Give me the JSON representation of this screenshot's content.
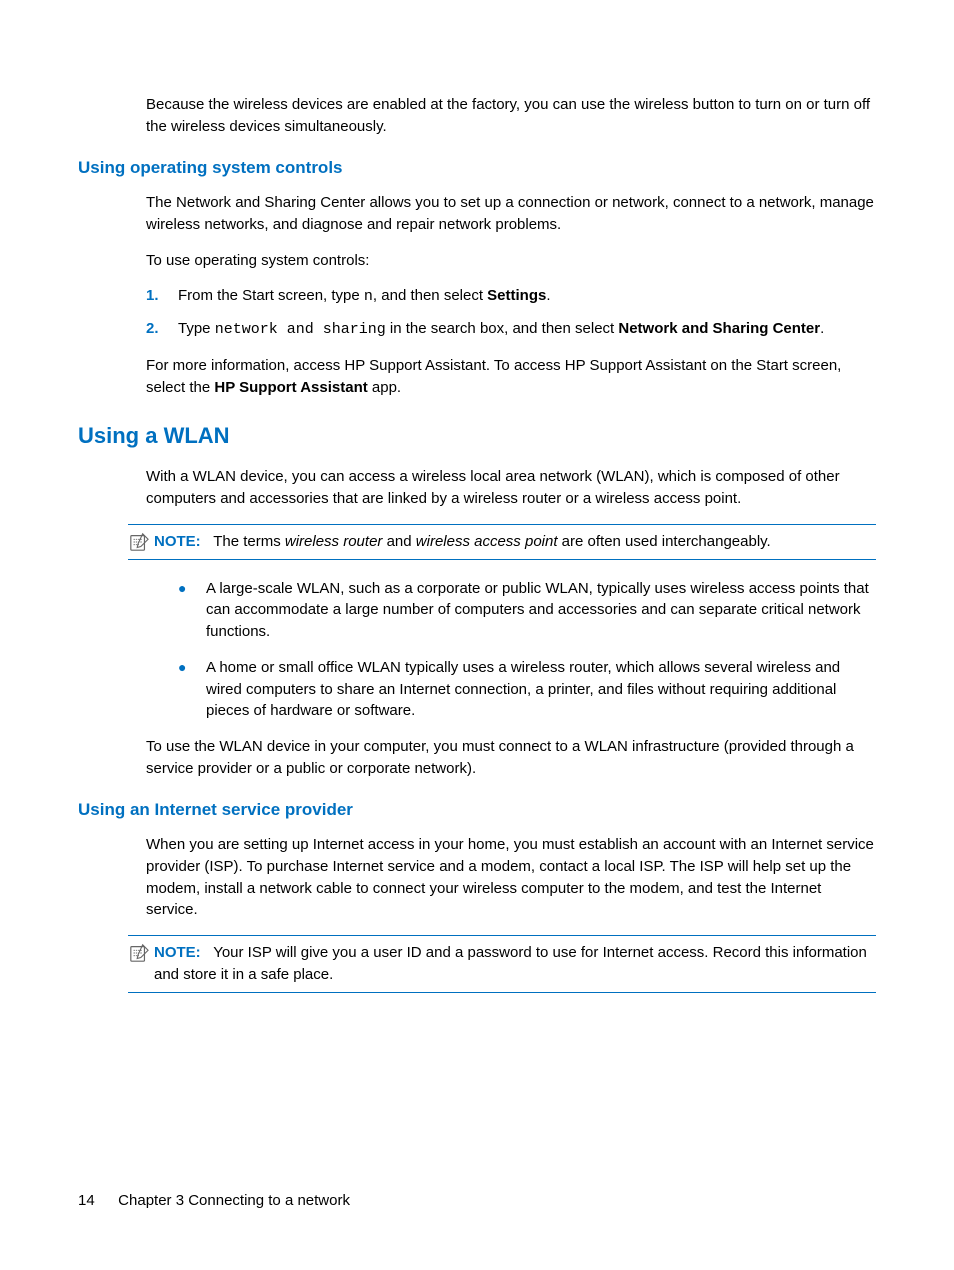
{
  "intro": "Because the wireless devices are enabled at the factory, you can use the wireless button to turn on or turn off the wireless devices simultaneously.",
  "s1": {
    "heading": "Using operating system controls",
    "p1": "The Network and Sharing Center allows you to set up a connection or network, connect to a network, manage wireless networks, and diagnose and repair network problems.",
    "p2": "To use operating system controls:",
    "li1_num": "1.",
    "li1_a": "From the Start screen, type ",
    "li1_mono": "n",
    "li1_b": ", and then select ",
    "li1_bold": "Settings",
    "li1_c": ".",
    "li2_num": "2.",
    "li2_a": "Type ",
    "li2_mono": "network and sharing",
    "li2_b": " in the search box, and then select ",
    "li2_bold": "Network and Sharing Center",
    "li2_c": ".",
    "p3_a": "For more information, access HP Support Assistant. To access HP Support Assistant on the Start screen, select the ",
    "p3_bold": "HP Support Assistant",
    "p3_b": " app."
  },
  "s2": {
    "heading": "Using a WLAN",
    "p1": "With a WLAN device, you can access a wireless local area network (WLAN), which is composed of other computers and accessories that are linked by a wireless router or a wireless access point.",
    "note_label": "NOTE:",
    "note_a": "The terms ",
    "note_i1": "wireless router",
    "note_b": " and ",
    "note_i2": "wireless access point",
    "note_c": " are often used interchangeably.",
    "b1": "A large-scale WLAN, such as a corporate or public WLAN, typically uses wireless access points that can accommodate a large number of computers and accessories and can separate critical network functions.",
    "b2": "A home or small office WLAN typically uses a wireless router, which allows several wireless and wired computers to share an Internet connection, a printer, and files without requiring additional pieces of hardware or software.",
    "p2": "To use the WLAN device in your computer, you must connect to a WLAN infrastructure (provided through a service provider or a public or corporate network)."
  },
  "s3": {
    "heading": "Using an Internet service provider",
    "p1": "When you are setting up Internet access in your home, you must establish an account with an Internet service provider (ISP). To purchase Internet service and a modem, contact a local ISP. The ISP will help set up the modem, install a network cable to connect your wireless computer to the modem, and test the Internet service.",
    "note_label": "NOTE:",
    "note_text": "Your ISP will give you a user ID and a password to use for Internet access. Record this information and store it in a safe place."
  },
  "footer": {
    "page": "14",
    "chapter": "Chapter 3   Connecting to a network"
  }
}
